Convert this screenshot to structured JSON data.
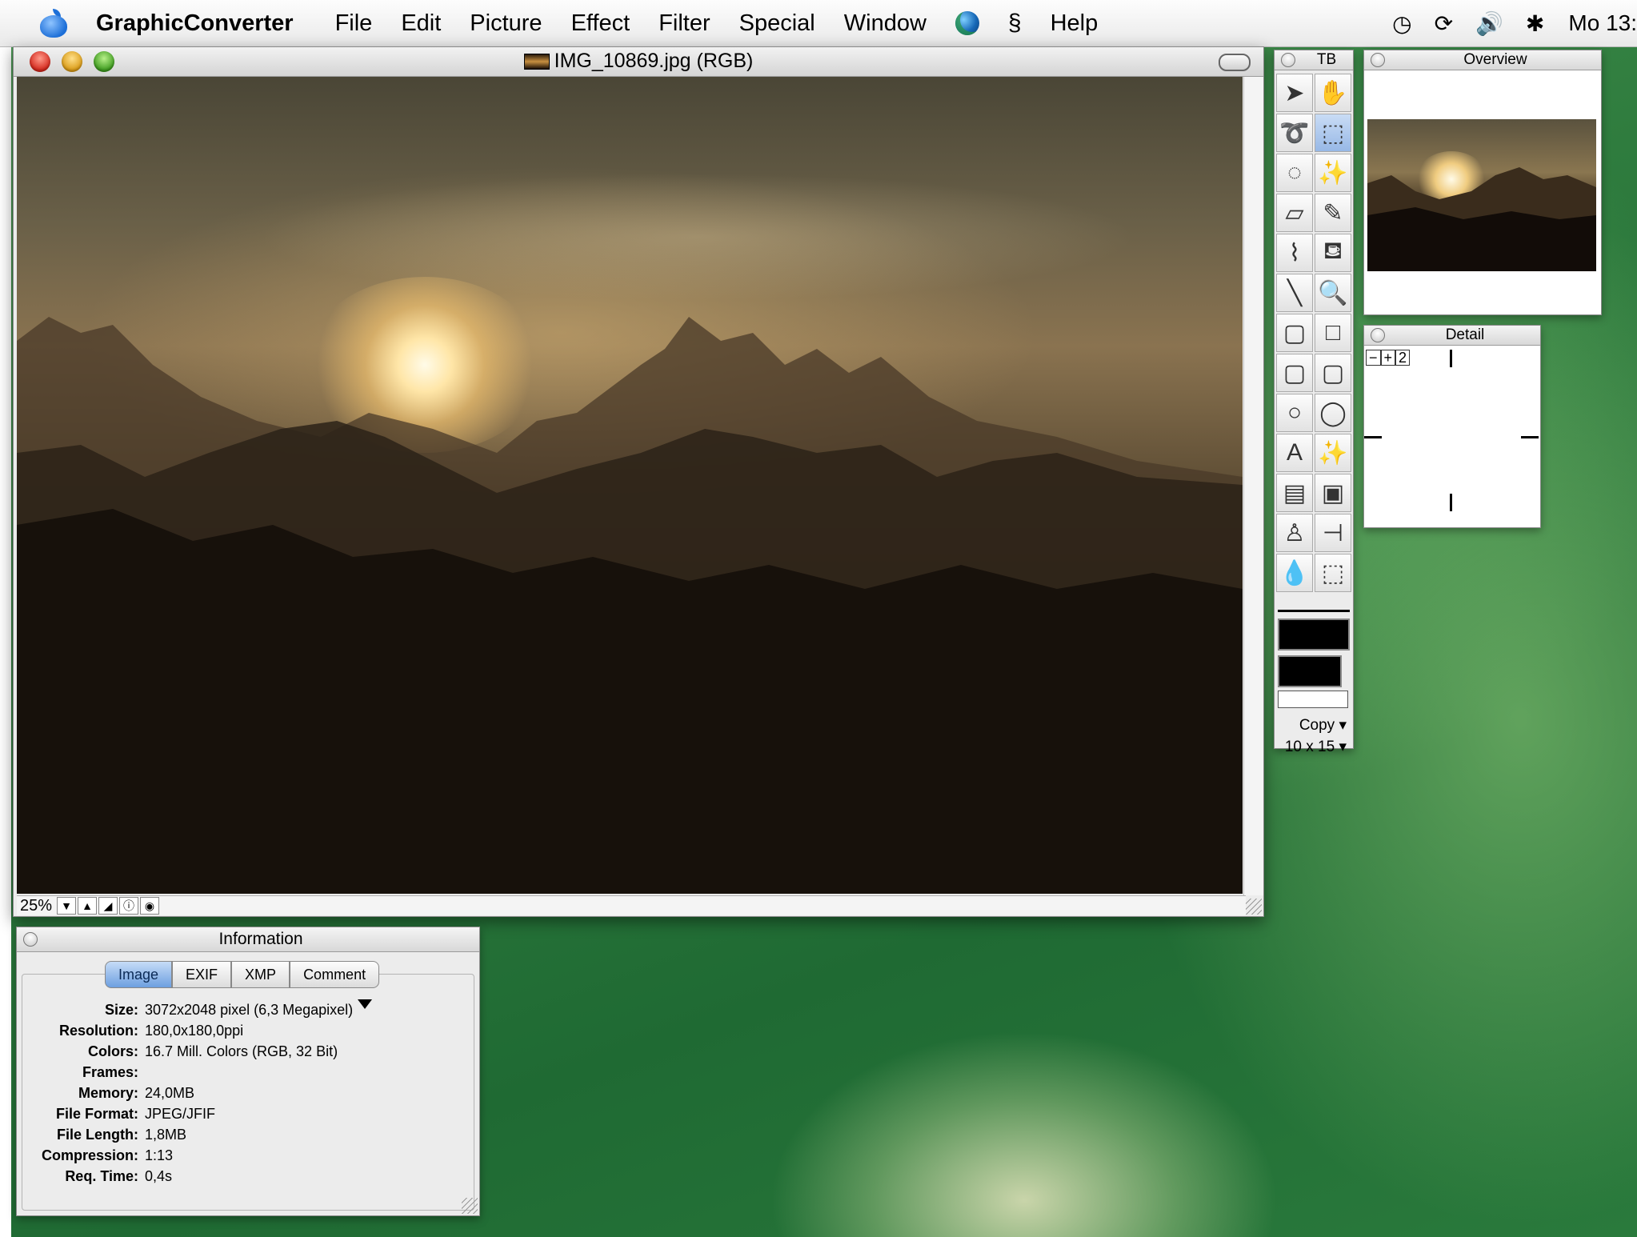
{
  "menubar": {
    "app_name": "GraphicConverter",
    "items": [
      "File",
      "Edit",
      "Picture",
      "Effect",
      "Filter",
      "Special",
      "Window",
      "Help"
    ],
    "clock": "Mo 13:"
  },
  "document": {
    "title": "IMG_10869.jpg (RGB)",
    "zoom": "25%"
  },
  "toolbox": {
    "title": "TB",
    "copy_label": "Copy",
    "size_label": "10 x 15"
  },
  "overview": {
    "title": "Overview"
  },
  "detail": {
    "title": "Detail",
    "zoom_value": "2"
  },
  "information": {
    "title": "Information",
    "tabs": [
      "Image",
      "EXIF",
      "XMP",
      "Comment"
    ],
    "active_tab": "Image",
    "rows": [
      {
        "label": "Size:",
        "value": "3072x2048 pixel (6,3 Megapixel)"
      },
      {
        "label": "Resolution:",
        "value": "180,0x180,0ppi"
      },
      {
        "label": "Colors:",
        "value": "16.7 Mill. Colors (RGB, 32 Bit)"
      },
      {
        "label": "Frames:",
        "value": ""
      },
      {
        "label": "Memory:",
        "value": "24,0MB"
      },
      {
        "label": "File Format:",
        "value": "JPEG/JFIF"
      },
      {
        "label": "File Length:",
        "value": "1,8MB"
      },
      {
        "label": "Compression:",
        "value": "1:13"
      },
      {
        "label": "Req. Time:",
        "value": "0,4s"
      }
    ]
  }
}
